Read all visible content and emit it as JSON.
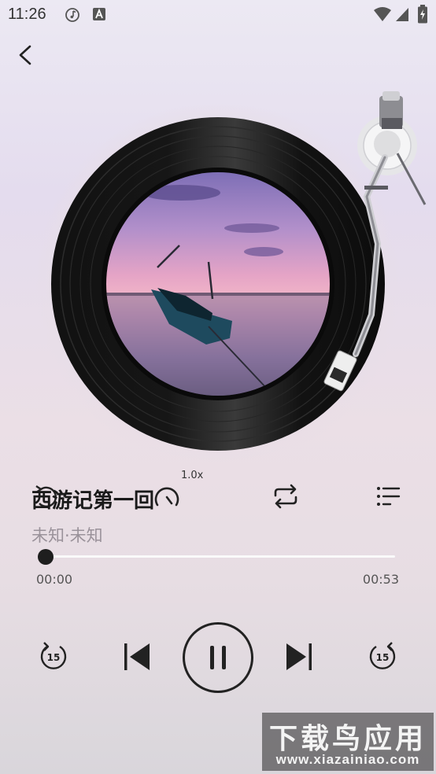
{
  "status_bar": {
    "time": "11:26",
    "icons": [
      "music-note-icon",
      "font-a-icon",
      "wifi-icon",
      "signal-icon",
      "battery-charging-icon"
    ]
  },
  "nav": {
    "back_icon": "chevron-left-icon"
  },
  "now_playing": {
    "title": "西游记第一回",
    "artist": "未知·未知",
    "speed": "1.0x"
  },
  "progress": {
    "elapsed": "00:00",
    "total": "00:53",
    "fraction": 0.0
  },
  "controls": {
    "icons": [
      "rewind-15-icon",
      "previous-icon",
      "pause-icon",
      "next-icon",
      "forward-15-icon"
    ],
    "skip_seconds": "15",
    "secondary_icons": [
      "speed-dial-icon",
      "repeat-icon",
      "playlist-icon"
    ]
  },
  "watermark": {
    "line1": "下载鸟应用",
    "line2": "www.xiazainiao.com"
  },
  "colors": {
    "accent": "#1e1e1e",
    "track": "#fafafa",
    "muted_text": "#9a929a"
  }
}
